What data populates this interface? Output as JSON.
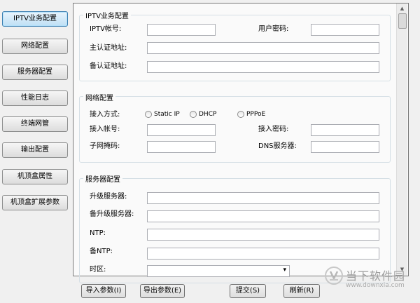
{
  "nav": {
    "items": [
      {
        "label": "IPTV业务配置"
      },
      {
        "label": "网络配置"
      },
      {
        "label": "服务器配置"
      },
      {
        "label": "性能日志"
      },
      {
        "label": "终端网管"
      },
      {
        "label": "输出配置"
      },
      {
        "label": "机顶盒属性"
      },
      {
        "label": "机顶盒扩展参数"
      }
    ],
    "active_index": 0
  },
  "iptv": {
    "title": "IPTV业务配置",
    "account_label": "IPTV帐号:",
    "account_value": "",
    "password_label": "用户密码:",
    "password_value": "",
    "auth_label": "主认证地址:",
    "auth_value": "",
    "backup_auth_label": "备认证地址:",
    "backup_auth_value": ""
  },
  "network": {
    "title": "网络配置",
    "access_mode_label": "接入方式:",
    "modes": [
      "Static IP",
      "DHCP",
      "PPPoE"
    ],
    "access_account_label": "接入帐号:",
    "access_account_value": "",
    "access_password_label": "接入密码:",
    "access_password_value": "",
    "subnet_label": "子网掩码:",
    "subnet_value": "",
    "dns_label": "DNS服务器:",
    "dns_value": ""
  },
  "server": {
    "title": "服务器配置",
    "upgrade_label": "升级服务器:",
    "upgrade_value": "",
    "backup_upgrade_label": "备升级服务器:",
    "backup_upgrade_value": "",
    "ntp_label": "NTP:",
    "ntp_value": "",
    "backup_ntp_label": "备NTP:",
    "backup_ntp_value": "",
    "timezone_label": "时区:",
    "timezone_value": ""
  },
  "buttons": {
    "import": "导入参数(I)",
    "export": "导出参数(E)",
    "submit": "提交(S)",
    "refresh": "刷新(R)"
  },
  "watermark": {
    "name": "当下软件园",
    "url": "www.downxia.com"
  }
}
